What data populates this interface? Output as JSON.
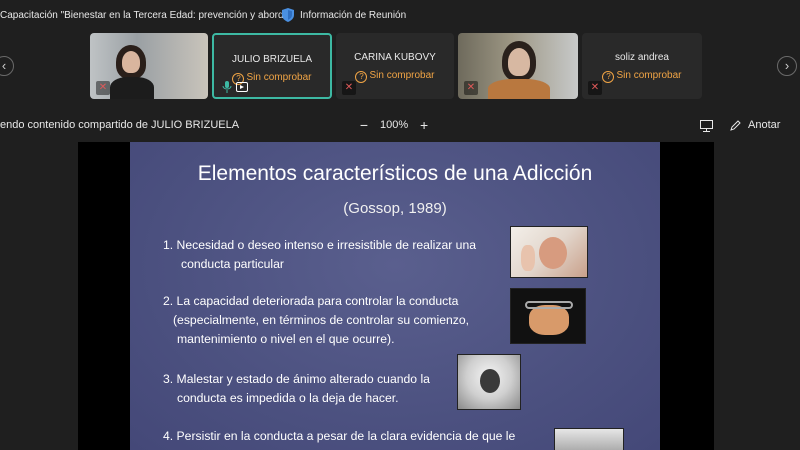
{
  "window": {
    "title": "Capacitación \"Bienestar en la Tercera Edad: prevención y abord...",
    "meeting_info_label": "Información de Reunión"
  },
  "participants": [
    {
      "name": "",
      "status": "",
      "video": true
    },
    {
      "name": "JULIO BRIZUELA",
      "status": "Sin comprobar",
      "video": false,
      "active": true
    },
    {
      "name": "CARINA KUBOVY",
      "status": "Sin comprobar",
      "video": false
    },
    {
      "name": "",
      "status": "",
      "video": true
    },
    {
      "name": "soliz andrea",
      "status": "Sin comprobar",
      "video": false
    }
  ],
  "share_bar": {
    "text": "endo contenido compartido de JULIO BRIZUELA",
    "zoom_minus": "−",
    "zoom_level": "100%",
    "zoom_plus": "+",
    "annotate_label": "Anotar"
  },
  "slide": {
    "title": "Elementos característicos de una Adicción",
    "reference": "(Gossop, 1989)",
    "items": [
      {
        "line1": "1. Necesidad o deseo intenso e irresistible de realizar una",
        "line2": "conducta particular",
        "line3": ""
      },
      {
        "line1": "2. La capacidad deteriorada para controlar la conducta",
        "line2": "(especialmente, en términos de controlar su comienzo,",
        "line3": "mantenimiento o nivel en el que ocurre)."
      },
      {
        "line1": "3. Malestar y estado de ánimo alterado cuando la",
        "line2": "conducta es impedida o la deja de hacer.",
        "line3": ""
      },
      {
        "line1": "4. Persistir en la conducta a pesar de la clara evidencia de que le",
        "line2": "",
        "line3": ""
      }
    ]
  },
  "colors": {
    "accent_active": "#3db9a3",
    "warning": "#f0a445",
    "muted_mic": "#e05a5a",
    "slide_bg": "#4c5180"
  },
  "icons": [
    "shield-icon",
    "chevron-left-icon",
    "chevron-right-icon",
    "mic-off-icon",
    "mic-icon",
    "camera-icon",
    "warning-icon",
    "whiteboard-icon",
    "pen-icon"
  ]
}
